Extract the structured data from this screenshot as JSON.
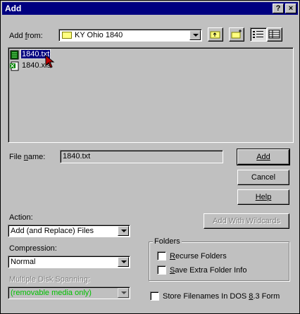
{
  "window": {
    "title": "Add",
    "help_btn": "?",
    "close_btn": "×"
  },
  "add_from": {
    "label": "Add from:",
    "value": "KY Ohio 1840"
  },
  "files": [
    {
      "name": "1840.txt",
      "icon": "text-file-icon",
      "selected": true
    },
    {
      "name": "1840.xls",
      "icon": "excel-file-icon",
      "selected": false
    }
  ],
  "file_name": {
    "label": "File name:",
    "value": "1840.txt"
  },
  "buttons": {
    "add": "Add",
    "cancel": "Cancel",
    "help": "Help",
    "add_wildcards": "Add With Wildcards"
  },
  "action": {
    "label": "Action:",
    "value": "Add (and Replace) Files"
  },
  "compression": {
    "label": "Compression:",
    "value": "Normal"
  },
  "spanning": {
    "label": "Multiple Disk Spanning:",
    "value": "(removable media only)",
    "color": "#00c000"
  },
  "folders": {
    "label": "Folders",
    "recurse": "Recurse Folders",
    "save_extra": "Save Extra Folder Info"
  },
  "dos83": "Store Filenames In DOS 8.3 Form",
  "colors": {
    "titlebar": "#000080",
    "face": "#c0c0c0",
    "selection": "#000080"
  }
}
